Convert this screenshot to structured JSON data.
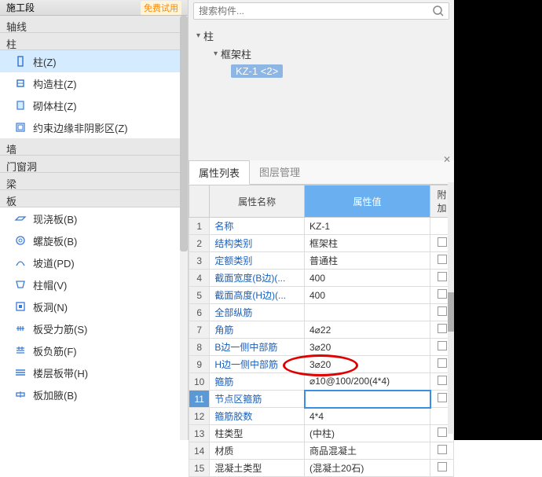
{
  "header": {
    "construction": "施工段",
    "free_trial": "免费试用"
  },
  "categories": {
    "axis": "轴线",
    "column": "柱",
    "wall": "墙",
    "opening": "门窗洞",
    "beam": "梁",
    "slab": "板"
  },
  "column_items": [
    {
      "label": "柱(Z)",
      "selected": true
    },
    {
      "label": "构造柱(Z)",
      "selected": false
    },
    {
      "label": "砌体柱(Z)",
      "selected": false
    },
    {
      "label": "约束边缘非阴影区(Z)",
      "selected": false
    }
  ],
  "slab_items": [
    {
      "label": "现浇板(B)"
    },
    {
      "label": "螺旋板(B)"
    },
    {
      "label": "坡道(PD)"
    },
    {
      "label": "柱帽(V)"
    },
    {
      "label": "板洞(N)"
    },
    {
      "label": "板受力筋(S)"
    },
    {
      "label": "板负筋(F)"
    },
    {
      "label": "楼层板带(H)"
    },
    {
      "label": "板加腋(B)"
    }
  ],
  "search": {
    "placeholder": "搜索构件..."
  },
  "tree": {
    "root": "柱",
    "sub": "框架柱",
    "leaf": "KZ-1  <2>"
  },
  "tabs": {
    "properties": "属性列表",
    "layers": "图层管理"
  },
  "columns": {
    "name": "属性名称",
    "value": "属性值",
    "extra": "附加"
  },
  "rows": [
    {
      "n": "1",
      "name": "名称",
      "value": "KZ-1",
      "blue": true,
      "check": false
    },
    {
      "n": "2",
      "name": "结构类别",
      "value": "框架柱",
      "blue": true,
      "check": true
    },
    {
      "n": "3",
      "name": "定额类别",
      "value": "普通柱",
      "blue": true,
      "check": true
    },
    {
      "n": "4",
      "name": "截面宽度(B边)(...",
      "value": "400",
      "blue": true,
      "check": true
    },
    {
      "n": "5",
      "name": "截面高度(H边)(...",
      "value": "400",
      "blue": true,
      "check": true
    },
    {
      "n": "6",
      "name": "全部纵筋",
      "value": "",
      "blue": true,
      "check": true
    },
    {
      "n": "7",
      "name": "角筋",
      "value": "4⌀22",
      "blue": true,
      "check": true
    },
    {
      "n": "8",
      "name": "B边一侧中部筋",
      "value": "3⌀20",
      "blue": true,
      "check": true
    },
    {
      "n": "9",
      "name": "H边一侧中部筋",
      "value": "3⌀20",
      "blue": true,
      "check": true
    },
    {
      "n": "10",
      "name": "箍筋",
      "value": "⌀10@100/200(4*4)",
      "blue": true,
      "check": true
    },
    {
      "n": "11",
      "name": "节点区箍筋",
      "value": "",
      "blue": true,
      "check": true,
      "selected": true
    },
    {
      "n": "12",
      "name": "箍筋胶数",
      "value": "4*4",
      "blue": true,
      "check": false
    },
    {
      "n": "13",
      "name": "柱类型",
      "value": "(中柱)",
      "blue": false,
      "check": true
    },
    {
      "n": "14",
      "name": "材质",
      "value": "商品混凝土",
      "blue": false,
      "check": true
    },
    {
      "n": "15",
      "name": "混凝土类型",
      "value": "(混凝土20石)",
      "blue": false,
      "check": true
    }
  ]
}
